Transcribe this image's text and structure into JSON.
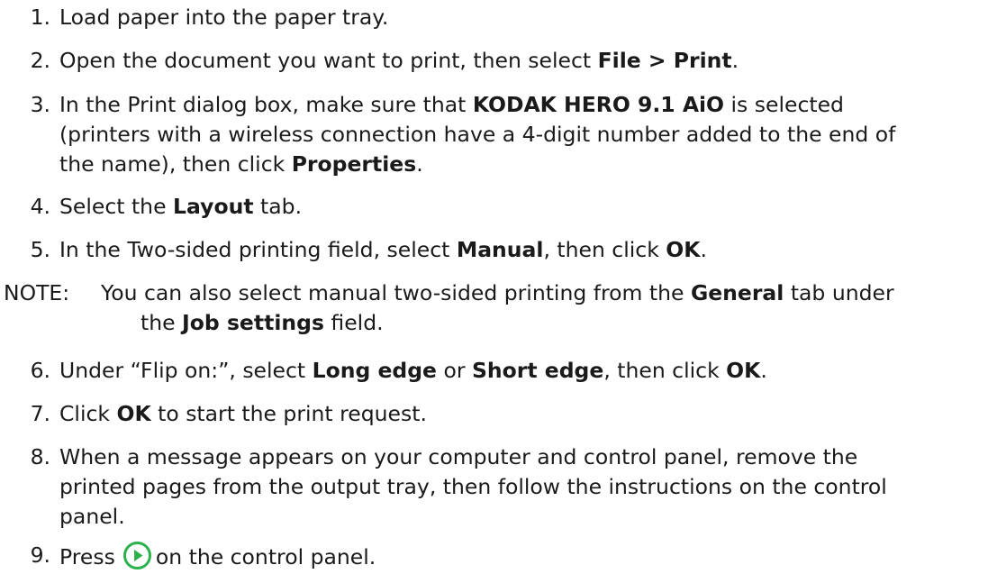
{
  "steps": [
    {
      "num": "1.",
      "text": "Load paper into the paper tray."
    },
    {
      "num": "2.",
      "pre": "Open the document you want to print, then select ",
      "b1": "File > Print",
      "post": "."
    },
    {
      "num": "3.",
      "line1_pre": "In the Print dialog box, make sure that ",
      "line1_b": "KODAK HERO 9.1 AiO",
      "line1_post": " is selected",
      "line2": "(printers with a wireless connection have a 4-digit number added to the end of",
      "line3_pre": "the name), then click ",
      "line3_b": "Properties",
      "line3_post": "."
    },
    {
      "num": "4.",
      "pre": "Select the ",
      "b1": "Layout",
      "post": " tab."
    },
    {
      "num": "5.",
      "pre": "In the Two-sided printing field, select ",
      "b1": "Manual",
      "mid": ", then click ",
      "b2": "OK",
      "post": "."
    },
    {
      "num": "6.",
      "pre": "Under “Flip on:”, select ",
      "b1": "Long edge",
      "mid": " or ",
      "b2": "Short edge",
      "mid2": ", then click ",
      "b3": "OK",
      "post": "."
    },
    {
      "num": "7.",
      "pre": "Click ",
      "b1": "OK",
      "post": " to start the print request."
    },
    {
      "num": "8.",
      "line1": "When a message appears on your computer and control panel, remove the",
      "line2": "printed pages from the output tray, then follow the instructions on the control",
      "line3": "panel."
    },
    {
      "num": "9.",
      "pre": "Press",
      "post": "on the control panel.",
      "icon": "play-button-icon"
    }
  ],
  "note": {
    "label": "NOTE:",
    "line1_pre": "You can also select manual two-sided printing from the ",
    "line1_b": "General",
    "line1_post": " tab under",
    "line2_pre": "the ",
    "line2_b": "Job settings",
    "line2_post": " field."
  },
  "colors": {
    "text": "#1a1a1a",
    "play_icon": "#2bb24c"
  }
}
